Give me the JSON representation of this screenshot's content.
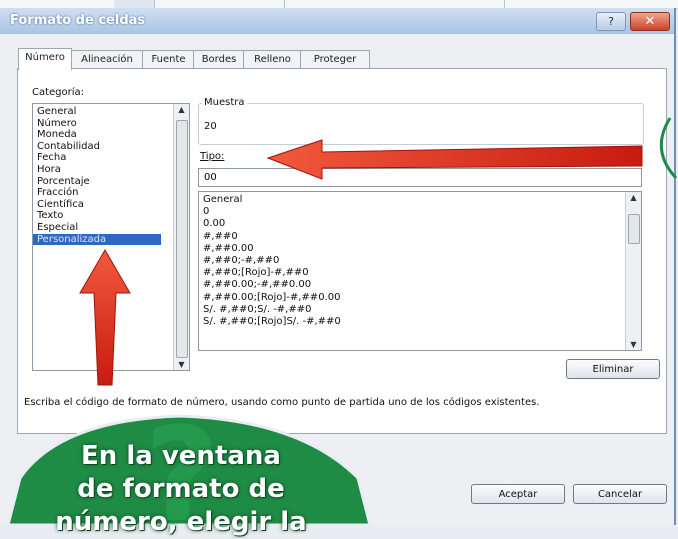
{
  "window": {
    "title": "Formato de celdas",
    "help_label": "?",
    "close_label": "✕"
  },
  "tabs": [
    {
      "label": "Número",
      "active": true
    },
    {
      "label": "Alineación",
      "active": false
    },
    {
      "label": "Fuente",
      "active": false
    },
    {
      "label": "Bordes",
      "active": false
    },
    {
      "label": "Relleno",
      "active": false
    },
    {
      "label": "Proteger",
      "active": false
    }
  ],
  "category": {
    "label": "Categoría:",
    "items": [
      "General",
      "Número",
      "Moneda",
      "Contabilidad",
      "Fecha",
      "Hora",
      "Porcentaje",
      "Fracción",
      "Científica",
      "Texto",
      "Especial",
      "Personalizada"
    ],
    "selected": "Personalizada"
  },
  "sample": {
    "label": "Muestra",
    "value": "20"
  },
  "type": {
    "label": "Tipo:",
    "value": "00"
  },
  "format_list": {
    "items": [
      "General",
      "0",
      "0.00",
      "#,##0",
      "#,##0.00",
      "#,##0;-#,##0",
      "#,##0;[Rojo]-#,##0",
      "#,##0.00;-#,##0.00",
      "#,##0.00;[Rojo]-#,##0.00",
      "S/. #,##0;S/. -#,##0",
      "S/. #,##0;[Rojo]S/. -#,##0"
    ]
  },
  "buttons": {
    "delete": "Eliminar",
    "ok": "Aceptar",
    "cancel": "Cancelar"
  },
  "description": "Escriba el código de formato de número, usando como punto de partida uno de los códigos existentes.",
  "callout": {
    "lines": [
      "En la ventana",
      "de formato de",
      "número, elegir la"
    ]
  },
  "colors": {
    "arrow": "#e02418",
    "callout_fill": "#1f8c45",
    "selection": "#3166c3"
  }
}
